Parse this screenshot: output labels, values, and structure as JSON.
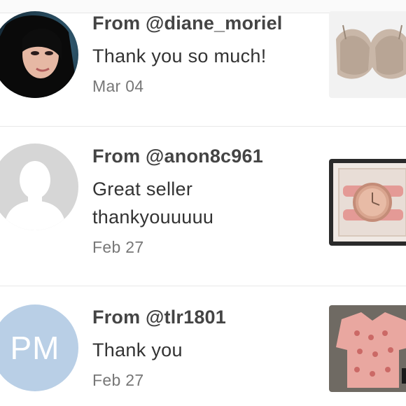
{
  "reviews": [
    {
      "from": "From @diane_moriel",
      "message": "Thank you so much!",
      "date": "Mar 04",
      "avatar_icon": "user-photo",
      "item_icon": "bra-photo"
    },
    {
      "from": "From @anon8c961",
      "message_line1": "Great seller",
      "message_line2": "thankyouuuuu",
      "date": "Feb 27",
      "avatar_icon": "default-user-icon",
      "item_icon": "watch-photo"
    },
    {
      "from": "From @tlr1801",
      "message": "Thank you",
      "date": "Feb 27",
      "avatar_initials": "PM",
      "item_icon": "blouse-photo"
    }
  ],
  "colors": {
    "initials_avatar_bg": "#b9cfe6",
    "default_avatar_bg": "#d6d6d6",
    "text_primary": "#444444",
    "text_muted": "#777777"
  }
}
